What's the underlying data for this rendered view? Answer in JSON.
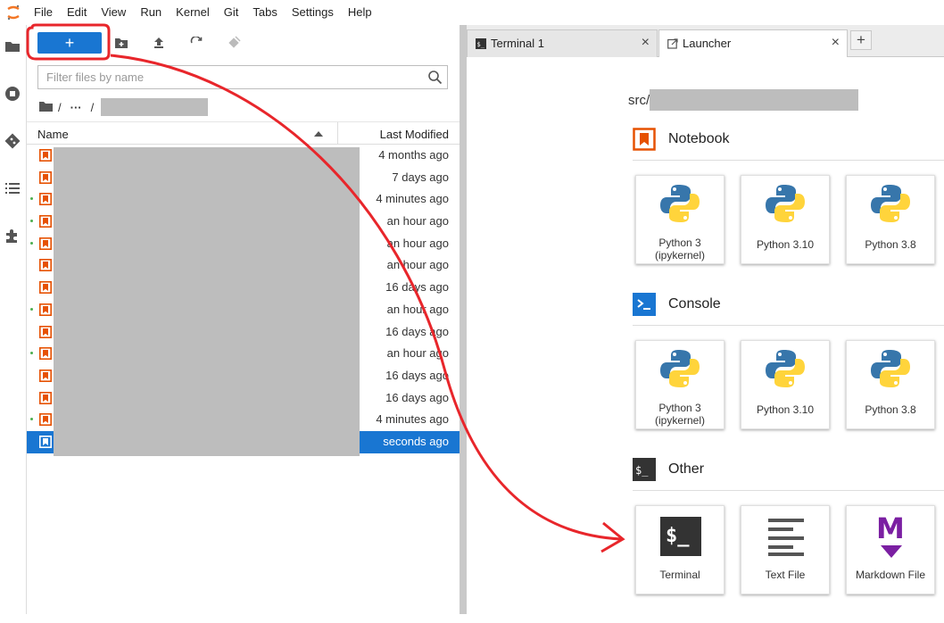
{
  "menubar": {
    "items": [
      "File",
      "Edit",
      "View",
      "Run",
      "Kernel",
      "Git",
      "Tabs",
      "Settings",
      "Help"
    ]
  },
  "filebrowser": {
    "new_label": "+",
    "filter_placeholder": "Filter files by name",
    "breadcrumb": {
      "sep1": "/",
      "ellipsis": "···",
      "sep2": "/"
    },
    "header": {
      "name": "Name",
      "last_modified": "Last Modified"
    },
    "rows": [
      {
        "modified": "4 months ago",
        "dot": false
      },
      {
        "modified": "7 days ago",
        "dot": false
      },
      {
        "modified": "4 minutes ago",
        "dot": true
      },
      {
        "modified": "an hour ago",
        "dot": true
      },
      {
        "modified": "an hour ago",
        "dot": true
      },
      {
        "modified": "an hour ago",
        "dot": false
      },
      {
        "modified": "16 days ago",
        "dot": false
      },
      {
        "modified": "an hour ago",
        "dot": true
      },
      {
        "modified": "16 days ago",
        "dot": false
      },
      {
        "modified": "an hour ago",
        "dot": true
      },
      {
        "modified": "16 days ago",
        "dot": false
      },
      {
        "modified": "16 days ago",
        "dot": false
      },
      {
        "modified": "4 minutes ago",
        "dot": true
      },
      {
        "modified": "seconds ago",
        "dot": false,
        "selected": true
      }
    ]
  },
  "tabs": {
    "terminal": "Terminal 1",
    "launcher": "Launcher",
    "close": "×",
    "add": "+"
  },
  "launcher": {
    "cwd": "src/",
    "notebook_title": "Notebook",
    "console_title": "Console",
    "other_title": "Other",
    "kernels": [
      {
        "line1": "Python 3",
        "line2": "(ipykernel)"
      },
      {
        "line1": "Python 3.10",
        "line2": ""
      },
      {
        "line1": "Python 3.8",
        "line2": ""
      }
    ],
    "other": {
      "terminal": "Terminal",
      "text_file": "Text File",
      "markdown_file": "Markdown File"
    },
    "terminal_glyph": "$_",
    "markdown_glyph": "M"
  },
  "colors": {
    "accent": "#1976d2",
    "notebook_orange": "#e65100",
    "console_blue": "#1976d2",
    "markdown_purple": "#7b1fa2",
    "annotation_red": "#e8262b"
  }
}
